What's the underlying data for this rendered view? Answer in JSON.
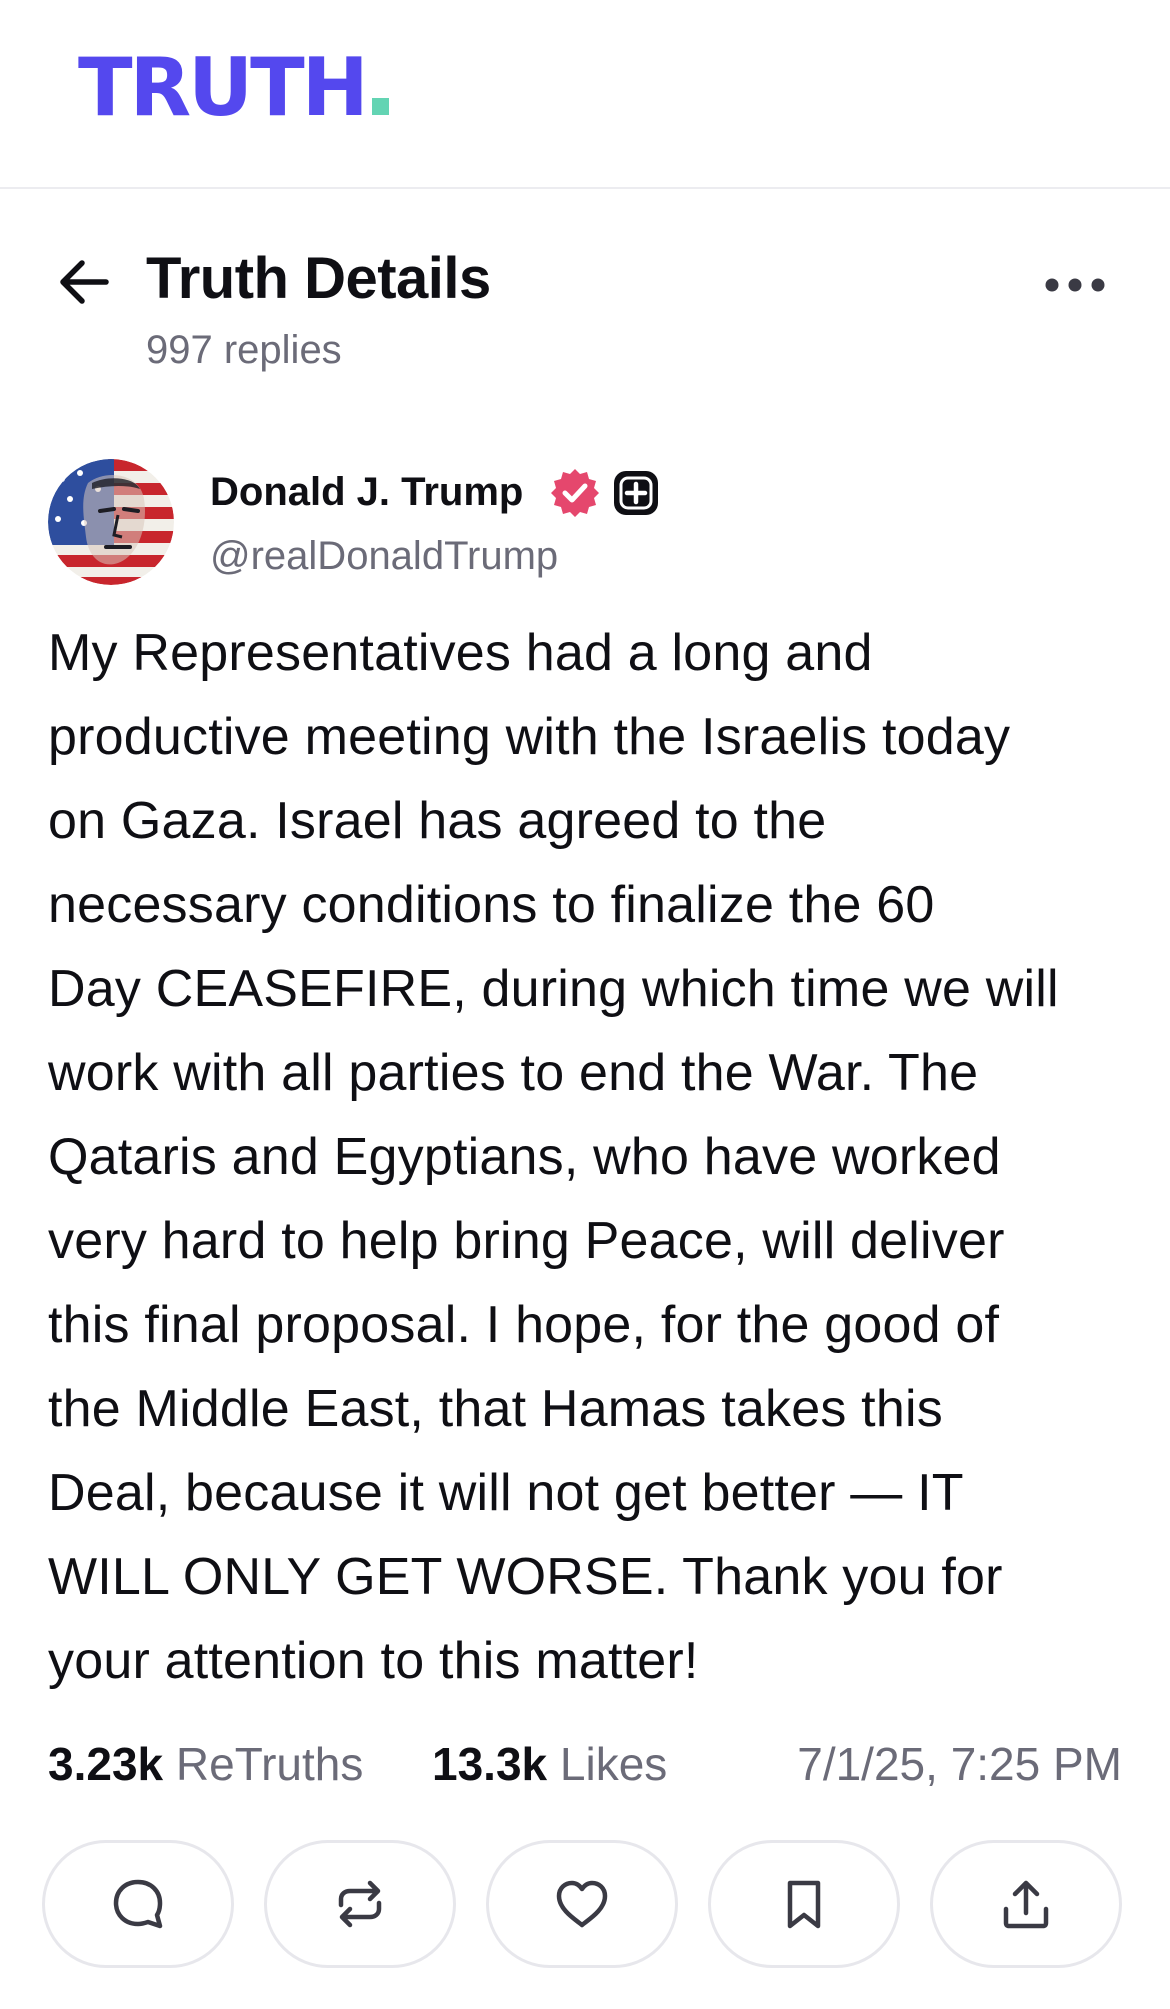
{
  "app": {
    "logo_text": "TRUTH",
    "brand_color": "#5448ee",
    "accent_color": "#63d4b3"
  },
  "header": {
    "title": "Truth Details",
    "reply_count": "997 replies",
    "back_icon": "arrow-left-icon",
    "more_icon": "more-horizontal-icon"
  },
  "author": {
    "name": "Donald J. Trump",
    "handle": "@realDonaldTrump",
    "verified_color": "#e5476d",
    "badges": [
      "verified-icon",
      "plus-badge-icon"
    ]
  },
  "post": {
    "text": "My Representatives had a long and\nproductive meeting with the Israelis today\non Gaza. Israel has agreed to the\nnecessary conditions to finalize the 60\nDay CEASEFIRE, during which time we will\nwork with all parties to end the War. The\nQataris and Egyptians, who have worked\nvery hard to help bring Peace, will deliver\nthis final proposal. I hope, for the good of\nthe Middle East, that Hamas takes this\nDeal, because it will not get better — IT\nWILL ONLY GET WORSE. Thank you for\nyour attention to this matter!"
  },
  "stats": {
    "retruths_count": "3.23k",
    "retruths_label": "ReTruths",
    "likes_count": "13.3k",
    "likes_label": "Likes",
    "timestamp": "7/1/25, 7:25 PM"
  },
  "actions": [
    {
      "icon": "reply-icon"
    },
    {
      "icon": "retruth-icon"
    },
    {
      "icon": "like-icon"
    },
    {
      "icon": "bookmark-icon"
    },
    {
      "icon": "share-icon"
    }
  ]
}
